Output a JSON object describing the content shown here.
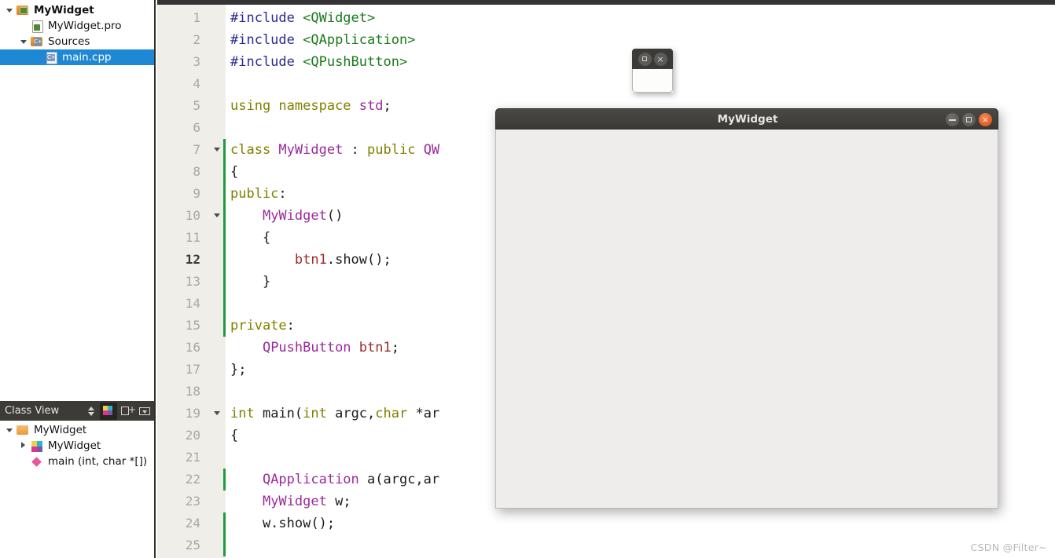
{
  "project_tree": {
    "items": [
      {
        "label": "MyWidget",
        "icon": "folder-qt-icon",
        "indent": 0,
        "arrow": "down",
        "bold": true,
        "selected": false
      },
      {
        "label": "MyWidget.pro",
        "icon": "qt-project-file-icon",
        "indent": 1,
        "arrow": "none",
        "bold": false,
        "selected": false
      },
      {
        "label": "Sources",
        "icon": "sources-folder-icon",
        "indent": 1,
        "arrow": "down",
        "bold": false,
        "selected": false
      },
      {
        "label": "main.cpp",
        "icon": "cpp-file-icon",
        "indent": 2,
        "arrow": "none",
        "bold": false,
        "selected": true
      }
    ]
  },
  "class_view": {
    "title": "Class View",
    "toolbar": [
      {
        "name": "sort-updown-button",
        "active": false
      },
      {
        "name": "sync-with-editor-button",
        "active": true
      },
      {
        "name": "add-split-button",
        "active": false
      },
      {
        "name": "panel-menu-button",
        "active": false
      }
    ],
    "items": [
      {
        "label": "MyWidget",
        "icon": "folder-icon",
        "indent": 0,
        "arrow": "down",
        "selected": false
      },
      {
        "label": "MyWidget",
        "icon": "class-icon",
        "indent": 1,
        "arrow": "right",
        "selected": false
      },
      {
        "label": "main (int, char *[])",
        "icon": "function-icon",
        "indent": 1,
        "arrow": "none",
        "selected": false
      }
    ]
  },
  "editor": {
    "current_line": 12,
    "lines": [
      {
        "n": 1,
        "fold": false,
        "change": false,
        "tokens": [
          {
            "t": "#include ",
            "c": "pp"
          },
          {
            "t": "<QWidget>",
            "c": "inc"
          }
        ]
      },
      {
        "n": 2,
        "fold": false,
        "change": false,
        "tokens": [
          {
            "t": "#include ",
            "c": "pp"
          },
          {
            "t": "<QApplication>",
            "c": "inc"
          }
        ]
      },
      {
        "n": 3,
        "fold": false,
        "change": false,
        "tokens": [
          {
            "t": "#include ",
            "c": "pp"
          },
          {
            "t": "<QPushButton>",
            "c": "inc"
          }
        ]
      },
      {
        "n": 4,
        "fold": false,
        "change": false,
        "tokens": []
      },
      {
        "n": 5,
        "fold": false,
        "change": false,
        "tokens": [
          {
            "t": "using namespace ",
            "c": "k"
          },
          {
            "t": "std",
            "c": "ty"
          },
          {
            "t": ";",
            "c": "op"
          }
        ]
      },
      {
        "n": 6,
        "fold": false,
        "change": false,
        "tokens": []
      },
      {
        "n": 7,
        "fold": true,
        "change": true,
        "tokens": [
          {
            "t": "class ",
            "c": "k"
          },
          {
            "t": "MyWidget",
            "c": "ty"
          },
          {
            "t": " : ",
            "c": "op"
          },
          {
            "t": "public ",
            "c": "k"
          },
          {
            "t": "QW",
            "c": "ty"
          }
        ]
      },
      {
        "n": 8,
        "fold": false,
        "change": true,
        "tokens": [
          {
            "t": "{",
            "c": "op"
          }
        ]
      },
      {
        "n": 9,
        "fold": false,
        "change": true,
        "tokens": [
          {
            "t": "public",
            "c": "k"
          },
          {
            "t": ":",
            "c": "op"
          }
        ]
      },
      {
        "n": 10,
        "fold": true,
        "change": true,
        "tokens": [
          {
            "t": "    ",
            "c": "op"
          },
          {
            "t": "MyWidget",
            "c": "ty"
          },
          {
            "t": "()",
            "c": "op"
          }
        ]
      },
      {
        "n": 11,
        "fold": false,
        "change": true,
        "tokens": [
          {
            "t": "    {",
            "c": "op"
          }
        ]
      },
      {
        "n": 12,
        "fold": false,
        "change": true,
        "tokens": [
          {
            "t": "        ",
            "c": "op"
          },
          {
            "t": "btn1",
            "c": "fld"
          },
          {
            "t": ".show();",
            "c": "op"
          }
        ]
      },
      {
        "n": 13,
        "fold": false,
        "change": true,
        "tokens": [
          {
            "t": "    }",
            "c": "op"
          }
        ]
      },
      {
        "n": 14,
        "fold": false,
        "change": true,
        "tokens": []
      },
      {
        "n": 15,
        "fold": false,
        "change": true,
        "tokens": [
          {
            "t": "private",
            "c": "k"
          },
          {
            "t": ":",
            "c": "op"
          }
        ]
      },
      {
        "n": 16,
        "fold": false,
        "change": false,
        "tokens": [
          {
            "t": "    ",
            "c": "op"
          },
          {
            "t": "QPushButton",
            "c": "ty"
          },
          {
            "t": " ",
            "c": "op"
          },
          {
            "t": "btn1",
            "c": "fld"
          },
          {
            "t": ";",
            "c": "op"
          }
        ]
      },
      {
        "n": 17,
        "fold": false,
        "change": false,
        "tokens": [
          {
            "t": "};",
            "c": "op"
          }
        ]
      },
      {
        "n": 18,
        "fold": false,
        "change": false,
        "tokens": []
      },
      {
        "n": 19,
        "fold": true,
        "change": false,
        "tokens": [
          {
            "t": "int ",
            "c": "k"
          },
          {
            "t": "main(",
            "c": "op"
          },
          {
            "t": "int ",
            "c": "k"
          },
          {
            "t": "argc,",
            "c": "op"
          },
          {
            "t": "char ",
            "c": "k"
          },
          {
            "t": "*ar",
            "c": "op"
          }
        ]
      },
      {
        "n": 20,
        "fold": false,
        "change": false,
        "tokens": [
          {
            "t": "{",
            "c": "op"
          }
        ]
      },
      {
        "n": 21,
        "fold": false,
        "change": false,
        "tokens": []
      },
      {
        "n": 22,
        "fold": false,
        "change": true,
        "tokens": [
          {
            "t": "    ",
            "c": "op"
          },
          {
            "t": "QApplication",
            "c": "ty"
          },
          {
            "t": " a(argc,ar",
            "c": "op"
          }
        ]
      },
      {
        "n": 23,
        "fold": false,
        "change": false,
        "tokens": [
          {
            "t": "    ",
            "c": "op"
          },
          {
            "t": "MyWidget",
            "c": "ty"
          },
          {
            "t": " w;",
            "c": "op"
          }
        ]
      },
      {
        "n": 24,
        "fold": false,
        "change": true,
        "tokens": [
          {
            "t": "    w.show();",
            "c": "op"
          }
        ]
      },
      {
        "n": 25,
        "fold": false,
        "change": true,
        "tokens": []
      }
    ]
  },
  "button_window": {
    "buttons": [
      {
        "name": "maximize-button",
        "glyph": "square"
      },
      {
        "name": "close-button",
        "glyph": "×"
      }
    ]
  },
  "widget_window": {
    "title": "MyWidget",
    "buttons": [
      {
        "name": "minimize-button",
        "glyph": "dash"
      },
      {
        "name": "maximize-button",
        "glyph": "square"
      },
      {
        "name": "close-button",
        "glyph": "×"
      }
    ]
  },
  "watermark": "CSDN @Filter~",
  "colors": {
    "selection_blue": "#1e88d4",
    "close_orange": "#dd4814",
    "change_bar_green": "#1f9b3d",
    "gutter_bg": "#efeee9",
    "panel_dark": "#3c3b37"
  }
}
